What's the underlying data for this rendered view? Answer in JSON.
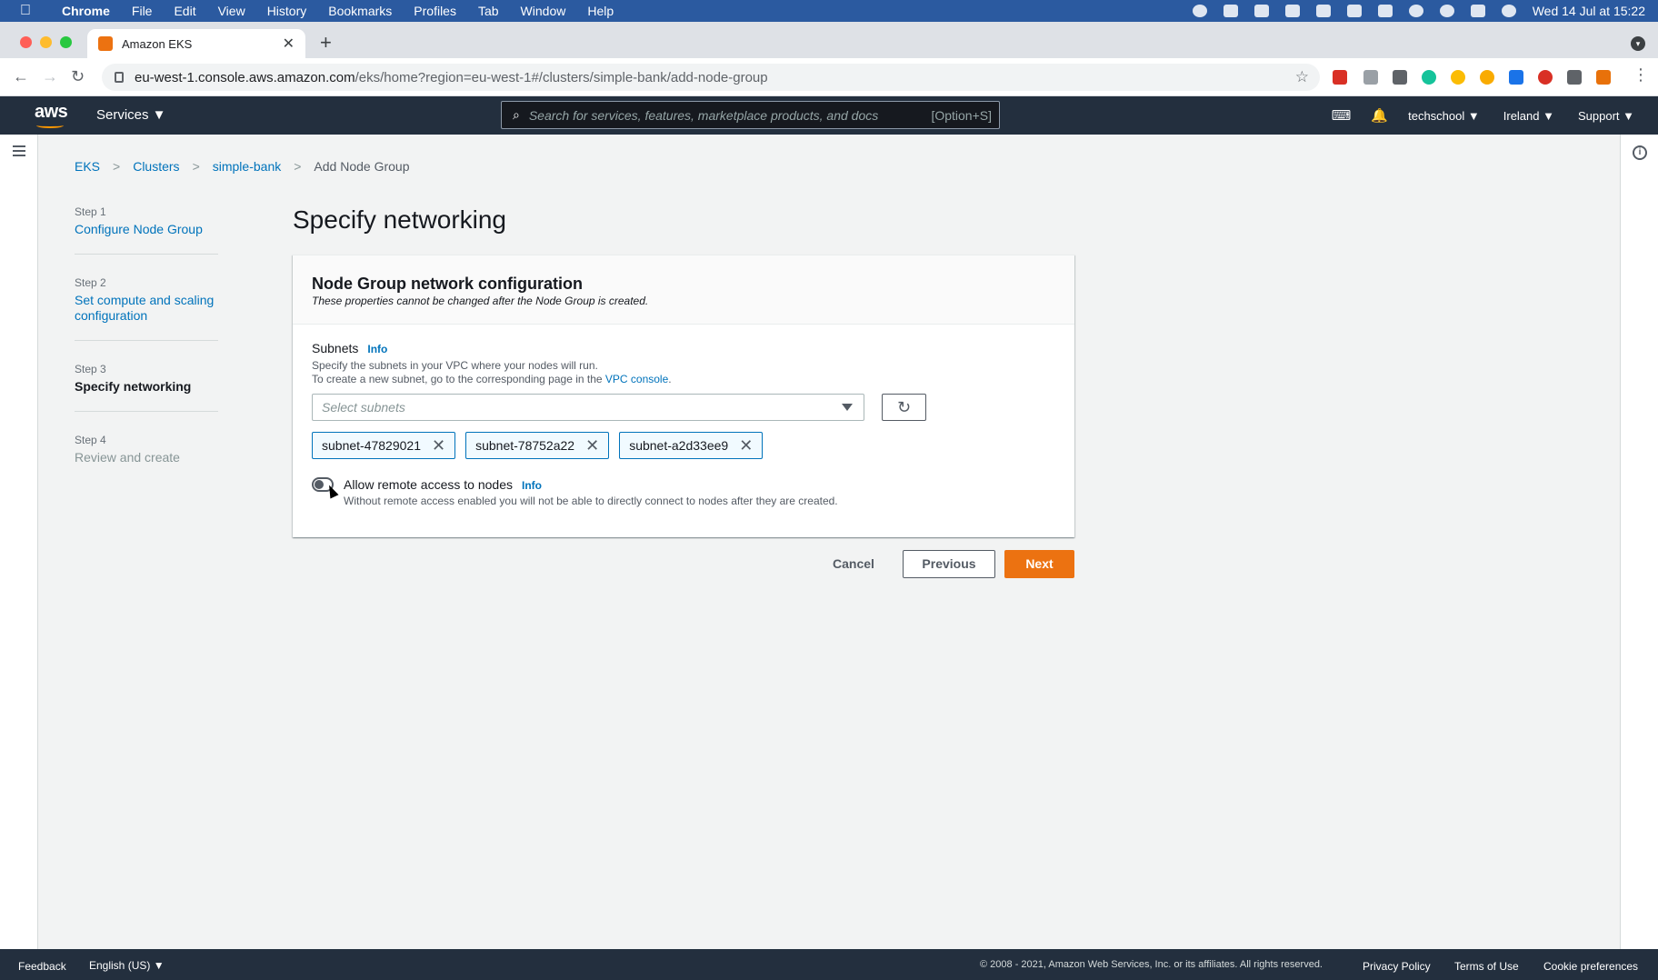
{
  "mac_menubar": {
    "apple": "",
    "items": [
      "Chrome",
      "File",
      "Edit",
      "View",
      "History",
      "Bookmarks",
      "Profiles",
      "Tab",
      "Window",
      "Help"
    ],
    "clock": "Wed 14 Jul at 15:22"
  },
  "browser": {
    "tab_title": "Amazon EKS",
    "url_host": "eu-west-1.console.aws.amazon.com",
    "url_path": "/eks/home?region=eu-west-1#/clusters/simple-bank/add-node-group"
  },
  "aws_header": {
    "logo": "aws",
    "services": "Services ▼",
    "search_placeholder": "Search for services, features, marketplace products, and docs",
    "search_shortcut": "[Option+S]",
    "account": "techschool ▼",
    "region": "Ireland ▼",
    "support": "Support ▼"
  },
  "breadcrumb": {
    "items": [
      "EKS",
      "Clusters",
      "simple-bank"
    ],
    "current": "Add Node Group"
  },
  "wizard": {
    "steps": [
      {
        "num": "Step 1",
        "label": "Configure Node Group"
      },
      {
        "num": "Step 2",
        "label": "Set compute and scaling configuration"
      },
      {
        "num": "Step 3",
        "label": "Specify networking"
      },
      {
        "num": "Step 4",
        "label": "Review and create"
      }
    ]
  },
  "main": {
    "title": "Specify networking",
    "panel": {
      "heading": "Node Group network configuration",
      "subheading": "These properties cannot be changed after the Node Group is created.",
      "subnets_label": "Subnets",
      "info": "Info",
      "desc1": "Specify the subnets in your VPC where your nodes will run.",
      "desc2": "To create a new subnet, go to the corresponding page in the",
      "vpc_link": "VPC console",
      "desc2_end": ".",
      "select_placeholder": "Select subnets",
      "subnets": [
        "subnet-47829021",
        "subnet-78752a22",
        "subnet-a2d33ee9"
      ],
      "remote_label": "Allow remote access to nodes",
      "remote_desc": "Without remote access enabled you will not be able to directly connect to nodes after they are created.",
      "remote_enabled": false
    },
    "actions": {
      "cancel": "Cancel",
      "previous": "Previous",
      "next": "Next"
    }
  },
  "footer": {
    "feedback": "Feedback",
    "language": "English (US) ▼",
    "copyright": "© 2008 - 2021, Amazon Web Services, Inc. or its affiliates. All rights reserved.",
    "privacy": "Privacy Policy",
    "terms": "Terms of Use",
    "cookies": "Cookie preferences"
  },
  "colors": {
    "aws_dark": "#232f3e",
    "link": "#0073bb",
    "primary": "#ec7211",
    "mac_bar": "#2b5aa0"
  }
}
